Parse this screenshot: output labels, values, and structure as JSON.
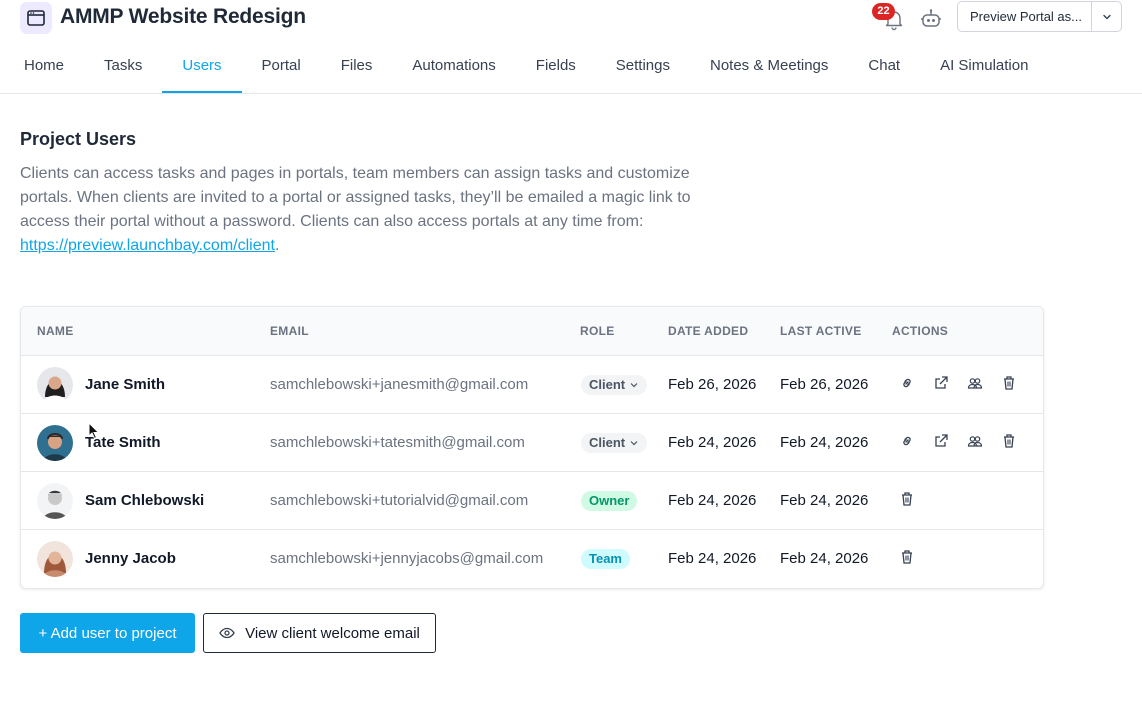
{
  "header": {
    "title": "AMMP Website Redesign",
    "notifications_count": "22",
    "preview_label": "Preview Portal as..."
  },
  "tabs": [
    {
      "label": "Home"
    },
    {
      "label": "Tasks"
    },
    {
      "label": "Users",
      "active": true
    },
    {
      "label": "Portal"
    },
    {
      "label": "Files"
    },
    {
      "label": "Automations"
    },
    {
      "label": "Fields"
    },
    {
      "label": "Settings"
    },
    {
      "label": "Notes & Meetings"
    },
    {
      "label": "Chat"
    },
    {
      "label": "AI Simulation"
    }
  ],
  "section": {
    "title": "Project Users",
    "description": "Clients can access tasks and pages in portals, team members can assign tasks and customize portals. When clients are invited to a portal or assigned tasks, they’ll be emailed a magic link to access their portal without a password. Clients can also access portals at any time from: ",
    "link": "https://preview.launchbay.com/client",
    "period": "."
  },
  "table": {
    "headers": {
      "name": "NAME",
      "email": "EMAIL",
      "role": "ROLE",
      "date_added": "DATE ADDED",
      "last_active": "LAST ACTIVE",
      "actions": "ACTIONS"
    },
    "rows": [
      {
        "name": "Jane Smith",
        "email": "samchlebowski+janesmith@gmail.com",
        "role": "Client",
        "date_added": "Feb 26, 2026",
        "last_active": "Feb 26, 2026",
        "actions": [
          "link-icon",
          "external-link-icon",
          "users-icon",
          "trash-icon"
        ]
      },
      {
        "name": "Tate Smith",
        "email": "samchlebowski+tatesmith@gmail.com",
        "role": "Client",
        "date_added": "Feb 24, 2026",
        "last_active": "Feb 24, 2026",
        "actions": [
          "link-icon",
          "external-link-icon",
          "users-icon",
          "trash-icon"
        ]
      },
      {
        "name": "Sam Chlebowski",
        "email": "samchlebowski+tutorialvid@gmail.com",
        "role": "Owner",
        "date_added": "Feb 24, 2026",
        "last_active": "Feb 24, 2026",
        "actions": [
          "trash-icon"
        ]
      },
      {
        "name": "Jenny Jacob",
        "email": "samchlebowski+jennyjacobs@gmail.com",
        "role": "Team",
        "date_added": "Feb 24, 2026",
        "last_active": "Feb 24, 2026",
        "actions": [
          "trash-icon"
        ]
      }
    ]
  },
  "buttons": {
    "add_user": "+ Add user to project",
    "view_welcome": "View client welcome email"
  },
  "colors": {
    "accent": "#0ea5e9",
    "badge_red": "#dc2626",
    "owner_green": "#059669",
    "team_cyan": "#0891b2"
  }
}
